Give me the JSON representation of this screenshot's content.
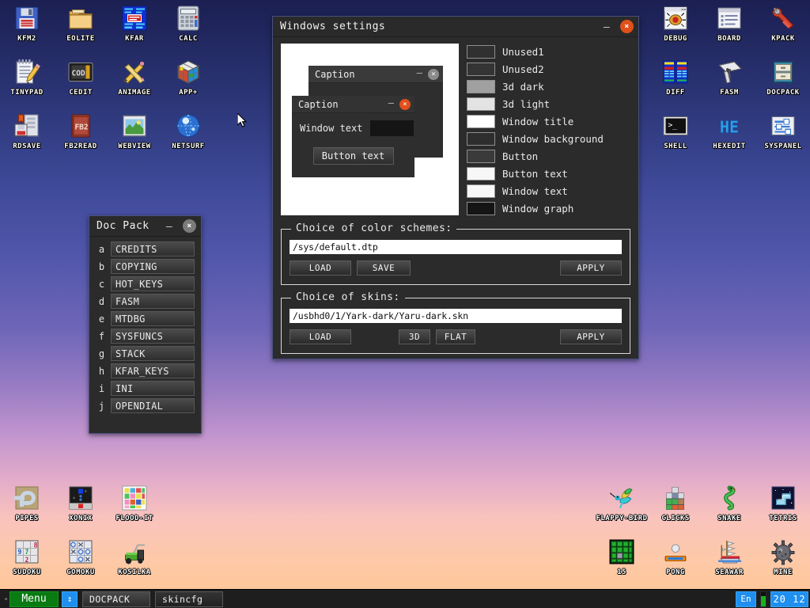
{
  "desktop": {
    "icons_top_left": [
      {
        "label": "KFM2",
        "icon": "floppy-disk-icon"
      },
      {
        "label": "EOLITE",
        "icon": "folder-icon"
      },
      {
        "label": "KFAR",
        "icon": "file-manager-icon"
      },
      {
        "label": "CALC",
        "icon": "calculator-icon"
      },
      {
        "label": "TINYPAD",
        "icon": "notepad-pencil-icon"
      },
      {
        "label": "CEDIT",
        "icon": "code-editor-icon"
      },
      {
        "label": "ANIMAGE",
        "icon": "pencil-brush-icon"
      },
      {
        "label": "APP+",
        "icon": "rubiks-cube-icon"
      },
      {
        "label": "RDSAVE",
        "icon": "ramdisk-save-icon"
      },
      {
        "label": "FB2READ",
        "icon": "fb2-book-icon"
      },
      {
        "label": "WEBVIEW",
        "icon": "web-browser-icon"
      },
      {
        "label": "NETSURF",
        "icon": "globe-icon"
      }
    ],
    "icons_top_right": [
      {
        "label": "DEBUG",
        "icon": "bug-window-icon"
      },
      {
        "label": "BOARD",
        "icon": "document-window-icon"
      },
      {
        "label": "KPACK",
        "icon": "wrench-icon"
      },
      {
        "label": "DIFF",
        "icon": "two-tables-icon"
      },
      {
        "label": "FASM",
        "icon": "assembler-icon"
      },
      {
        "label": "DOCPACK",
        "icon": "file-cabinet-icon"
      },
      {
        "label": "SHELL",
        "icon": "terminal-icon"
      },
      {
        "label": "HEXEDIT",
        "icon": "hex-editor-icon"
      },
      {
        "label": "SYSPANEL",
        "icon": "sliders-panel-icon"
      }
    ],
    "icons_bottom_left": [
      {
        "label": "PIPES",
        "icon": "pipes-game-icon"
      },
      {
        "label": "XONIX",
        "icon": "xonix-game-icon"
      },
      {
        "label": "FLOOD-IT",
        "icon": "flood-it-game-icon"
      },
      {
        "label": "SUDOKU",
        "icon": "sudoku-game-icon"
      },
      {
        "label": "GOMOKU",
        "icon": "gomoku-game-icon"
      },
      {
        "label": "KOSILKA",
        "icon": "lawnmower-icon"
      }
    ],
    "icons_bottom_right": [
      {
        "label": "FLAPPY-BIRD",
        "icon": "hummingbird-icon"
      },
      {
        "label": "CLICKS",
        "icon": "blocks-icon"
      },
      {
        "label": "SNAKE",
        "icon": "snake-icon"
      },
      {
        "label": "TETRIS",
        "icon": "tetris-icon"
      },
      {
        "label": "15",
        "icon": "fifteen-puzzle-icon"
      },
      {
        "label": "PONG",
        "icon": "pong-icon"
      },
      {
        "label": "SEAWAR",
        "icon": "sailing-ship-icon"
      },
      {
        "label": "MINE",
        "icon": "mine-icon"
      }
    ]
  },
  "settings_window": {
    "title": "Windows settings",
    "minimize_label": "–",
    "close_label": "×",
    "preview": {
      "back_window": {
        "caption": "Caption",
        "minimize": "–",
        "close": "×"
      },
      "front_window": {
        "caption": "Caption",
        "minimize": "–",
        "close": "×",
        "field_label": "Window text",
        "button_label": "Button text"
      }
    },
    "color_items": [
      {
        "label": "Unused1",
        "color": "#303030"
      },
      {
        "label": "Unused2",
        "color": "#343434"
      },
      {
        "label": "3d dark",
        "color": "#a0a0a0"
      },
      {
        "label": "3d light",
        "color": "#e3e3e3"
      },
      {
        "label": "Window title",
        "color": "#ffffff"
      },
      {
        "label": "Window background",
        "color": "#2e2e2e"
      },
      {
        "label": "Button",
        "color": "#3a3a3a"
      },
      {
        "label": "Button text",
        "color": "#f7f7f7"
      },
      {
        "label": "Window text",
        "color": "#f7f7f7"
      },
      {
        "label": "Window graph",
        "color": "#151515"
      }
    ],
    "color_schemes": {
      "legend": "Choice of color schemes:",
      "path": "/sys/default.dtp",
      "load_label": "LOAD",
      "save_label": "SAVE",
      "apply_label": "APPLY"
    },
    "skins": {
      "legend": "Choice of skins:",
      "path": "/usbhd0/1/Yark-dark/Yaru-dark.skn",
      "load_label": "LOAD",
      "three_d_label": "3D",
      "flat_label": "FLAT",
      "apply_label": "APPLY"
    }
  },
  "docpack_window": {
    "title": "Doc Pack",
    "minimize_label": "–",
    "close_label": "×",
    "items": [
      {
        "key": "a",
        "label": "CREDITS"
      },
      {
        "key": "b",
        "label": "COPYING"
      },
      {
        "key": "c",
        "label": "HOT_KEYS"
      },
      {
        "key": "d",
        "label": "FASM"
      },
      {
        "key": "e",
        "label": "MTDBG"
      },
      {
        "key": "f",
        "label": "SYSFUNCS"
      },
      {
        "key": "g",
        "label": "STACK"
      },
      {
        "key": "h",
        "label": "KFAR_KEYS"
      },
      {
        "key": "i",
        "label": "INI"
      },
      {
        "key": "j",
        "label": "OPENDIAL"
      }
    ]
  },
  "taskbar": {
    "collapse_arrow": "◂",
    "menu_label": "Menu",
    "resize_icon": "↕",
    "tasks": [
      {
        "label": "DOCPACK"
      },
      {
        "label": "skincfg"
      }
    ],
    "language": "En",
    "clock": "20 12",
    "accent_blue": "#1f8ff0",
    "menu_green": "#0a7a12"
  }
}
